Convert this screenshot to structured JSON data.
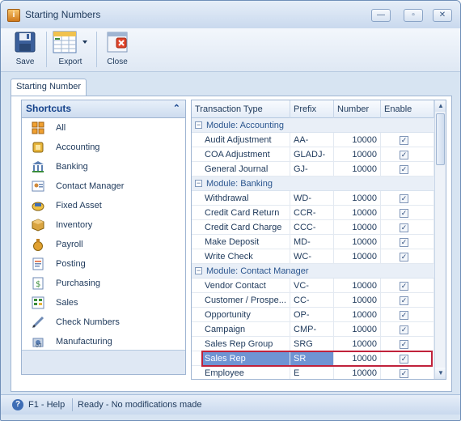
{
  "window": {
    "title": "Starting Numbers"
  },
  "window_controls": {
    "minimize": "—",
    "maximize": "▫",
    "close": "✕"
  },
  "toolbar": {
    "save_label": "Save",
    "export_label": "Export",
    "close_label": "Close"
  },
  "tabs": [
    {
      "label": "Starting Number"
    }
  ],
  "shortcuts": {
    "header": "Shortcuts",
    "collapse_glyph": "⌃",
    "items": [
      {
        "label": "All",
        "icon": "grid-all-icon"
      },
      {
        "label": "Accounting",
        "icon": "ledger-icon"
      },
      {
        "label": "Banking",
        "icon": "bank-icon"
      },
      {
        "label": "Contact Manager",
        "icon": "contact-card-icon"
      },
      {
        "label": "Fixed Asset",
        "icon": "asset-icon"
      },
      {
        "label": "Inventory",
        "icon": "box-icon"
      },
      {
        "label": "Payroll",
        "icon": "money-bag-icon"
      },
      {
        "label": "Posting",
        "icon": "posting-icon"
      },
      {
        "label": "Purchasing",
        "icon": "purchase-doc-icon"
      },
      {
        "label": "Sales",
        "icon": "sales-ledger-icon"
      },
      {
        "label": "Check Numbers",
        "icon": "pen-check-icon"
      },
      {
        "label": "Manufacturing",
        "icon": "gear-box-icon"
      }
    ]
  },
  "grid": {
    "columns": [
      "Transaction Type",
      "Prefix",
      "Number",
      "Enable"
    ],
    "groups": [
      {
        "label": "Module: Accounting",
        "rows": [
          {
            "type": "Audit Adjustment",
            "prefix": "AA-",
            "number": "10000",
            "enabled": true
          },
          {
            "type": "COA Adjustment",
            "prefix": "GLADJ-",
            "number": "10000",
            "enabled": true
          },
          {
            "type": "General Journal",
            "prefix": "GJ-",
            "number": "10000",
            "enabled": true
          }
        ]
      },
      {
        "label": "Module: Banking",
        "rows": [
          {
            "type": "Withdrawal",
            "prefix": "WD-",
            "number": "10000",
            "enabled": true
          },
          {
            "type": "Credit Card Return",
            "prefix": "CCR-",
            "number": "10000",
            "enabled": true
          },
          {
            "type": "Credit Card Charge",
            "prefix": "CCC-",
            "number": "10000",
            "enabled": true
          },
          {
            "type": "Make Deposit",
            "prefix": "MD-",
            "number": "10000",
            "enabled": true
          },
          {
            "type": "Write Check",
            "prefix": "WC-",
            "number": "10000",
            "enabled": true
          }
        ]
      },
      {
        "label": "Module: Contact Manager",
        "rows": [
          {
            "type": "Vendor Contact",
            "prefix": "VC-",
            "number": "10000",
            "enabled": true
          },
          {
            "type": "Customer / Prospe...",
            "prefix": "CC-",
            "number": "10000",
            "enabled": true
          },
          {
            "type": "Opportunity",
            "prefix": "OP-",
            "number": "10000",
            "enabled": true
          },
          {
            "type": "Campaign",
            "prefix": "CMP-",
            "number": "10000",
            "enabled": true
          },
          {
            "type": "Sales Rep Group",
            "prefix": "SRG",
            "number": "10000",
            "enabled": true
          },
          {
            "type": "Sales Rep",
            "prefix": "SR",
            "number": "10000",
            "enabled": true,
            "selected": true
          },
          {
            "type": "Employee",
            "prefix": "E",
            "number": "10000",
            "enabled": true
          }
        ]
      }
    ]
  },
  "status": {
    "help_label": "F1 - Help",
    "message": "Ready - No modifications made"
  },
  "colors": {
    "accent": "#15428b",
    "selection": "#6f94d3",
    "highlight_frame": "#c0223b"
  }
}
